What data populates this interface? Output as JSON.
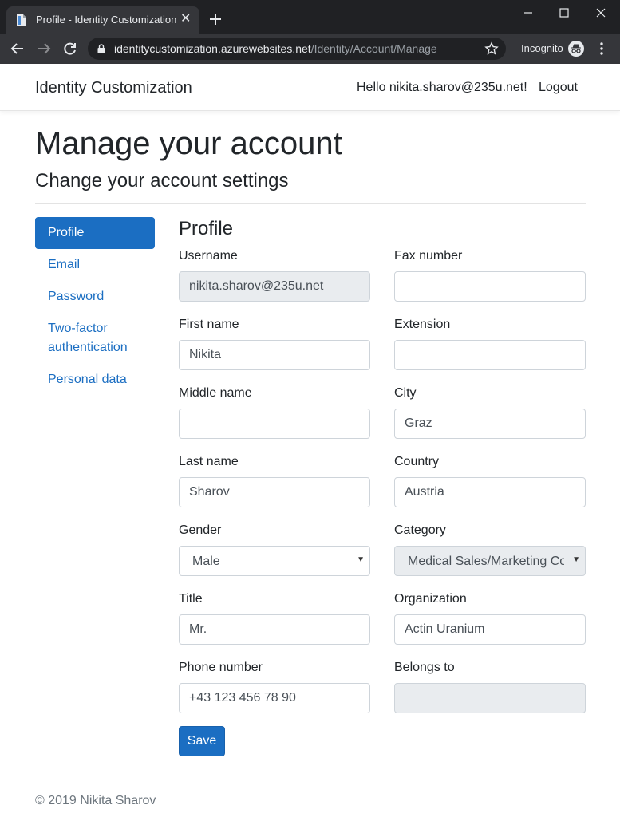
{
  "browser": {
    "tab_title": "Profile - Identity Customization",
    "url_host": "identitycustomization.azurewebsites.net",
    "url_path": "/Identity/Account/Manage",
    "incognito_label": "Incognito"
  },
  "navbar": {
    "brand": "Identity Customization",
    "hello": "Hello nikita.sharov@235u.net!",
    "logout": "Logout"
  },
  "header": {
    "title": "Manage your account",
    "subtitle": "Change your account settings"
  },
  "sidenav": {
    "items": [
      {
        "label": "Profile",
        "active": true
      },
      {
        "label": "Email"
      },
      {
        "label": "Password"
      },
      {
        "label": "Two-factor authentication"
      },
      {
        "label": "Personal data"
      }
    ]
  },
  "form": {
    "title": "Profile",
    "username": {
      "label": "Username",
      "value": "nikita.sharov@235u.net"
    },
    "first_name": {
      "label": "First name",
      "value": "Nikita"
    },
    "middle_name": {
      "label": "Middle name",
      "value": ""
    },
    "last_name": {
      "label": "Last name",
      "value": "Sharov"
    },
    "gender": {
      "label": "Gender",
      "value": "Male"
    },
    "title_field": {
      "label": "Title",
      "value": "Mr."
    },
    "phone": {
      "label": "Phone number",
      "value": "+43 123 456 78 90"
    },
    "fax": {
      "label": "Fax number",
      "value": ""
    },
    "extension": {
      "label": "Extension",
      "value": ""
    },
    "city": {
      "label": "City",
      "value": "Graz"
    },
    "country": {
      "label": "Country",
      "value": "Austria"
    },
    "category": {
      "label": "Category",
      "value": "Medical Sales/Marketing Co"
    },
    "organization": {
      "label": "Organization",
      "value": "Actin Uranium"
    },
    "belongs_to": {
      "label": "Belongs to",
      "value": ""
    },
    "save_label": "Save"
  },
  "footer": {
    "text": "© 2019 Nikita Sharov"
  },
  "colors": {
    "primary": "#1b6ec2",
    "chrome_dark": "#202124",
    "chrome_tab": "#35363a"
  }
}
